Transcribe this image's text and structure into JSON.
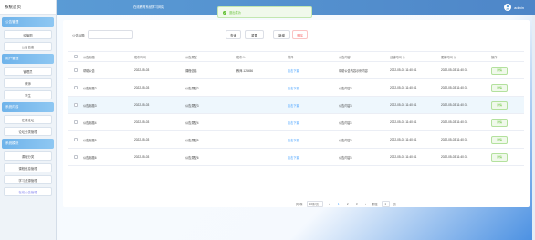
{
  "app": {
    "title": "系统首页",
    "header_title": "在线教育系统学习网站",
    "user": "admin"
  },
  "toast": {
    "text": "退出成功"
  },
  "sidebar": [
    {
      "section": "公告管理",
      "items": [
        "轮播图",
        "公告信息"
      ]
    },
    {
      "section": "用户管理",
      "items": [
        "管理员",
        "教师",
        "学生"
      ]
    },
    {
      "section": "系统内容",
      "items": [
        "在线论坛",
        "论坛分类管理"
      ]
    },
    {
      "section": "系统模块",
      "items": [
        "课程分类",
        "课程信息管理",
        "学习资源管理",
        "在线公告管理"
      ]
    }
  ],
  "search": {
    "label": "公告标题",
    "placeholder": "",
    "search_btn": "查询",
    "reset_btn": "重置",
    "add_btn": "新增",
    "delete_btn": "删除"
  },
  "table": {
    "headers": [
      "公告标题",
      "发布时间",
      "公告类型",
      "发布人",
      "附件",
      "公告内容",
      "创建时间 ⇅",
      "更新时间 ⇅",
      "操作"
    ],
    "rows": [
      [
        "帮助公告",
        "2022-05-03",
        "课程信息",
        "教师-123456",
        "点击下载",
        "帮助公告内容示例内容",
        "2022-05-03 11:40:31",
        "2022-05-03 11:40:31",
        "详情"
      ],
      [
        "公告标题2",
        "2022-05-03",
        "公告类型2",
        "",
        "点击下载",
        "公告内容2",
        "2022-05-03 11:40:31",
        "2022-05-03 11:40:31",
        "详情"
      ],
      [
        "公告标题3",
        "2022-05-03",
        "公告类型3",
        "",
        "点击下载",
        "公告内容3",
        "2022-05-03 11:40:31",
        "2022-05-03 11:40:31",
        "详情"
      ],
      [
        "公告标题4",
        "2022-05-03",
        "公告类型4",
        "",
        "点击下载",
        "公告内容4",
        "2022-05-03 11:40:31",
        "2022-05-03 11:40:31",
        "详情"
      ],
      [
        "公告标题5",
        "2022-05-03",
        "公告类型5",
        "",
        "点击下载",
        "公告内容5",
        "2022-05-03 11:40:31",
        "2022-05-03 11:40:31",
        "详情"
      ],
      [
        "公告标题6",
        "2022-05-03",
        "公告类型6",
        "",
        "点击下载",
        "公告内容6",
        "2022-05-03 11:40:31",
        "2022-05-03 11:40:31",
        "详情"
      ]
    ]
  },
  "pagination": {
    "total": "共6条",
    "page_size": "10条/页",
    "pages": [
      "1",
      "2",
      "3"
    ],
    "current": "1",
    "goto_label": "前往",
    "goto_value": "1",
    "page_unit": "页"
  }
}
